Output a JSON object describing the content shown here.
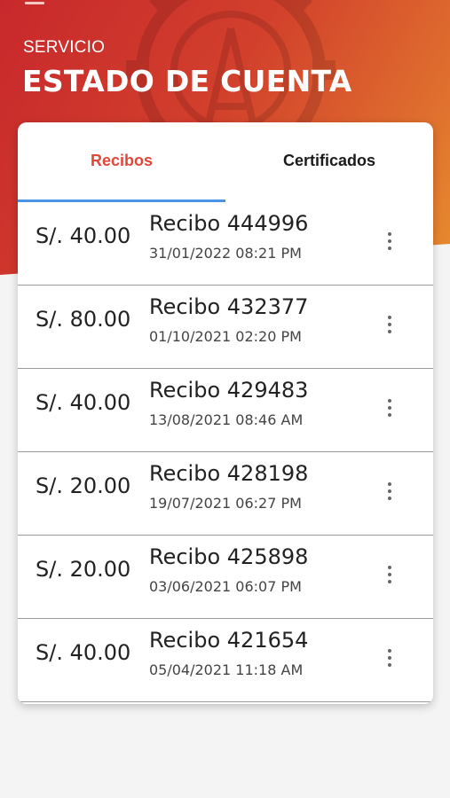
{
  "header": {
    "kicker": "SERVICIO",
    "title": "ESTADO DE CUENTA",
    "colors": {
      "gradient_start": "#c8282c",
      "gradient_end": "#e8902f"
    }
  },
  "tabs": [
    {
      "label": "Recibos",
      "active": true
    },
    {
      "label": "Certificados",
      "active": false
    }
  ],
  "accent_colors": {
    "active_tab": "#e0473a",
    "tab_indicator": "#4a93e6"
  },
  "receipts": [
    {
      "amount": "S/. 40.00",
      "title": "Recibo 444996",
      "date": "31/01/2022 08:21 PM"
    },
    {
      "amount": "S/. 80.00",
      "title": "Recibo 432377",
      "date": "01/10/2021 02:20 PM"
    },
    {
      "amount": "S/. 40.00",
      "title": "Recibo 429483",
      "date": "13/08/2021 08:46 AM"
    },
    {
      "amount": "S/. 20.00",
      "title": "Recibo 428198",
      "date": "19/07/2021 06:27 PM"
    },
    {
      "amount": "S/. 20.00",
      "title": "Recibo 425898",
      "date": "03/06/2021 06:07 PM"
    },
    {
      "amount": "S/. 40.00",
      "title": "Recibo 421654",
      "date": "05/04/2021 11:18 AM"
    }
  ],
  "icons": {
    "menu": "hamburger-menu-icon",
    "row_action": "more-vert-icon",
    "background": "gear-emblem"
  }
}
